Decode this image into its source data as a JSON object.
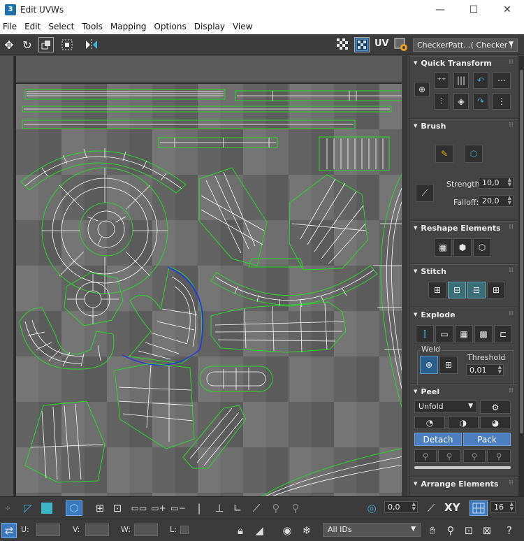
{
  "window": {
    "title": "Edit UVWs",
    "icon_label": "3",
    "controls": [
      "—",
      "☐",
      "✕"
    ]
  },
  "menubar": {
    "items": [
      "File",
      "Edit",
      "Select",
      "Tools",
      "Mapping",
      "Options",
      "Display",
      "View"
    ]
  },
  "toolbar": {
    "uv_label": "UV",
    "texture_select": "CheckerPatt...( Checker )"
  },
  "panel": {
    "quick_transform": {
      "title": "Quick Transform"
    },
    "brush": {
      "title": "Brush",
      "strength_label": "Strength:",
      "strength_value": "10,0",
      "falloff_label": "Falloff:",
      "falloff_value": "20,0"
    },
    "reshape": {
      "title": "Reshape Elements"
    },
    "stitch": {
      "title": "Stitch"
    },
    "explode": {
      "title": "Explode",
      "weld_label": "Weld",
      "threshold_label": "Threshold",
      "threshold_value": "0,01"
    },
    "peel": {
      "title": "Peel",
      "mode_select": "Unfold",
      "detach_label": "Detach",
      "pack_label": "Pack"
    },
    "arrange": {
      "title": "Arrange Elements"
    }
  },
  "bottombar": {
    "rotate_value": "0,0",
    "xy_label": "XY",
    "grid_value": "16",
    "u_label": "U:",
    "v_label": "V:",
    "w_label": "W:",
    "l_label": "L:",
    "id_select": "All IDs"
  },
  "colors": {
    "seam_green": "#2fd42f",
    "wire_white": "#ffffff",
    "selected_blue": "#2b3bd6",
    "accent_blue": "#4c7fc0"
  }
}
